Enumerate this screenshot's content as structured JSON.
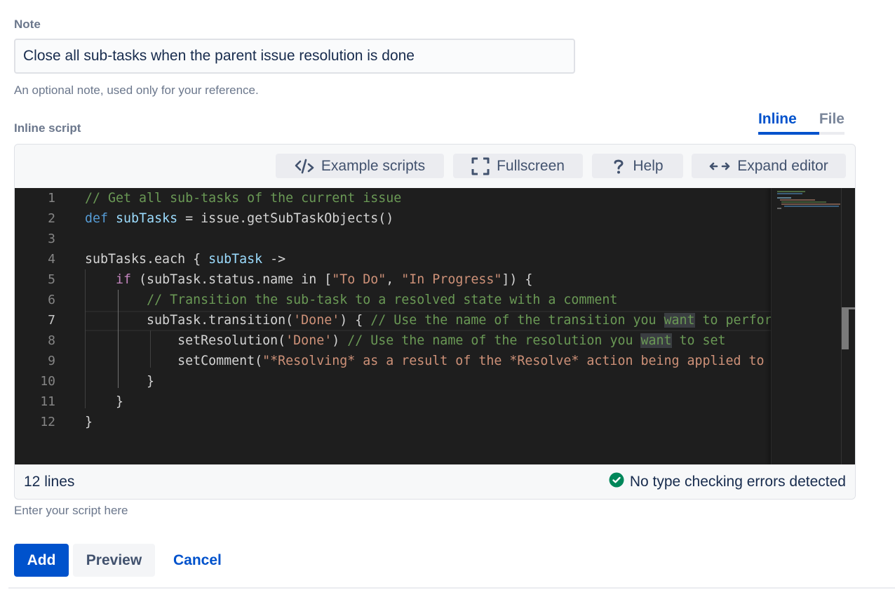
{
  "note": {
    "label": "Note",
    "value": "Close all sub-tasks when the parent issue resolution is done",
    "helper": "An optional note, used only for your reference."
  },
  "script": {
    "label": "Inline script",
    "helper": "Enter your script here",
    "tabs": [
      {
        "label": "Inline",
        "active": true
      },
      {
        "label": "File",
        "active": false
      }
    ],
    "toolbar": {
      "example_scripts": {
        "label": "Example scripts",
        "icon": "code-icon"
      },
      "fullscreen": {
        "label": "Fullscreen",
        "icon": "fullscreen-icon"
      },
      "help": {
        "label": "Help",
        "icon": "question-icon"
      },
      "expand_editor": {
        "label": "Expand editor",
        "icon": "expand-arrows-icon"
      }
    },
    "line_numbers": [
      "1",
      "2",
      "3",
      "4",
      "5",
      "6",
      "7",
      "8",
      "9",
      "10",
      "11",
      "12"
    ],
    "current_line": 7,
    "code": [
      [
        {
          "t": "// Get all sub-tasks of the current issue",
          "c": "comment"
        }
      ],
      [
        {
          "t": "def",
          "c": "kw"
        },
        {
          "t": " "
        },
        {
          "t": "subTasks",
          "c": "var"
        },
        {
          "t": " = issue.getSubTaskObjects()"
        }
      ],
      [],
      [
        {
          "t": "subTasks.each { "
        },
        {
          "t": "subTask",
          "c": "var"
        },
        {
          "t": " ->"
        }
      ],
      [
        {
          "t": "    "
        },
        {
          "t": "if",
          "c": "kw2"
        },
        {
          "t": " (subTask.status.name in ["
        },
        {
          "t": "\"To Do\"",
          "c": "str"
        },
        {
          "t": ", "
        },
        {
          "t": "\"In Progress\"",
          "c": "str"
        },
        {
          "t": "]) {"
        }
      ],
      [
        {
          "t": "        "
        },
        {
          "t": "// Transition the sub-task to a resolved state with a comment",
          "c": "comment"
        }
      ],
      [
        {
          "t": "        subTask.transition("
        },
        {
          "t": "'Done'",
          "c": "str"
        },
        {
          "t": ") { "
        },
        {
          "t": "// Use the name of the transition you ",
          "c": "comment"
        },
        {
          "t": "want",
          "c": "comment hl"
        },
        {
          "t": " to perform",
          "c": "comment"
        }
      ],
      [
        {
          "t": "            setResolution("
        },
        {
          "t": "'Done'",
          "c": "str"
        },
        {
          "t": ") "
        },
        {
          "t": "// Use the name of the resolution you ",
          "c": "comment"
        },
        {
          "t": "want",
          "c": "comment hl"
        },
        {
          "t": " to set",
          "c": "comment"
        }
      ],
      [
        {
          "t": "            setComment("
        },
        {
          "t": "\"*Resolving* as a result of the *Resolve* action being applied to the parent.\"",
          "c": "str"
        },
        {
          "t": ")"
        }
      ],
      [
        {
          "t": "        }"
        }
      ],
      [
        {
          "t": "    }"
        }
      ],
      [
        {
          "t": "}"
        }
      ]
    ],
    "status": {
      "line_count": "12 lines",
      "type_check": "No type checking errors detected",
      "type_check_color": "#00875a"
    }
  },
  "actions": {
    "add": "Add",
    "preview": "Preview",
    "cancel": "Cancel"
  },
  "colors": {
    "primary": "#0052cc",
    "success": "#00875a",
    "editor_bg": "#1e1e1e"
  }
}
